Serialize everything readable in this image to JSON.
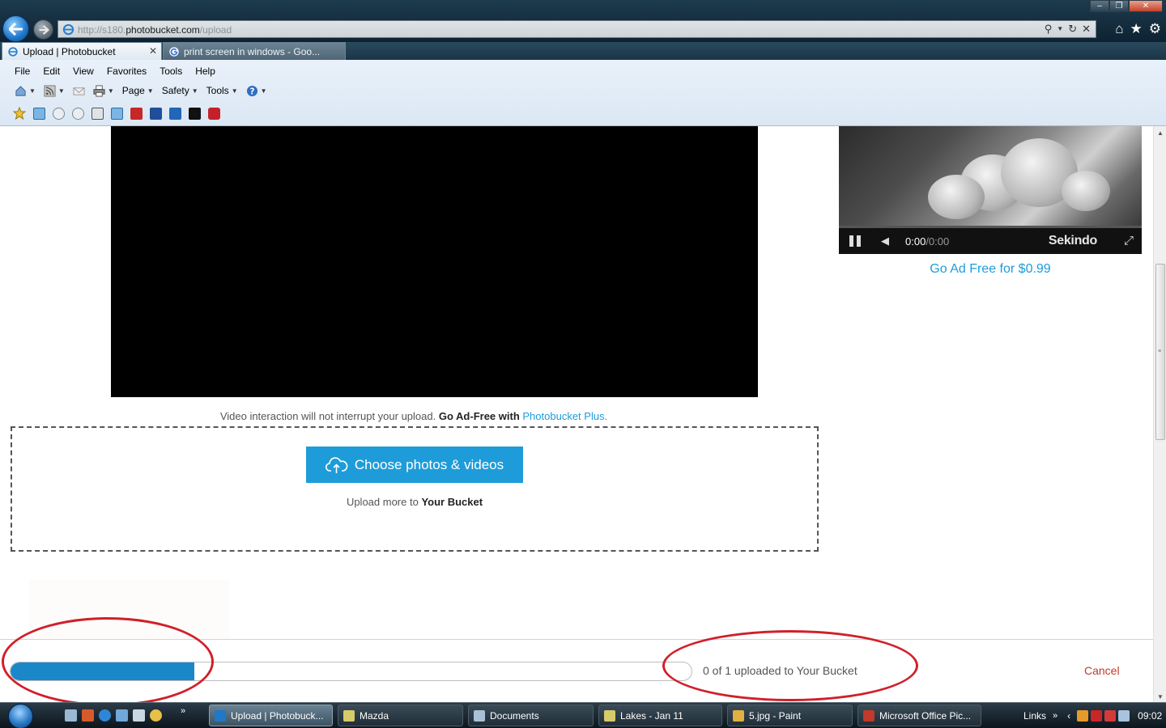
{
  "browser": {
    "address": {
      "scheme": "http://s180.",
      "host": "photobucket.com",
      "path": "/upload"
    },
    "tabs": [
      {
        "label": "Upload | Photobucket",
        "active": true
      },
      {
        "label": "print screen in windows - Goo...",
        "active": false
      }
    ],
    "menu": [
      "File",
      "Edit",
      "View",
      "Favorites",
      "Tools",
      "Help"
    ],
    "commands": {
      "page": "Page",
      "safety": "Safety",
      "tools": "Tools"
    }
  },
  "ad": {
    "time_current": "0:00",
    "time_duration": "/0:00",
    "brand": "Sekindo",
    "ad_free_link": "Go Ad Free for $0.99"
  },
  "upload": {
    "video_note_prefix": "Video interaction will not interrupt your upload.",
    "video_note_bold": "Go Ad-Free with",
    "video_note_link": "Photobucket Plus.",
    "choose_button": "Choose photos & videos",
    "upload_more_prefix": "Upload more to",
    "upload_more_bucket": "Your Bucket",
    "status": "0 of 1 uploaded to Your Bucket",
    "cancel": "Cancel",
    "progress_percent": 27
  },
  "taskbar": {
    "items": [
      {
        "label": "Upload | Photobuck...",
        "active": true,
        "color": "#1f78c8"
      },
      {
        "label": "Mazda",
        "active": false,
        "color": "#d8c96a"
      },
      {
        "label": "Documents",
        "active": false,
        "color": "#a9c0d6"
      },
      {
        "label": "Lakes - Jan 11",
        "active": false,
        "color": "#d8c96a"
      },
      {
        "label": "5.jpg - Paint",
        "active": false,
        "color": "#e0b040"
      },
      {
        "label": "Microsoft Office Pic...",
        "active": false,
        "color": "#c0392b"
      }
    ],
    "links": "Links",
    "clock": "09:02"
  },
  "colors": {
    "accent": "#1e9cd9",
    "progress": "#1a87c9",
    "cancel": "#c0392b",
    "annotation": "#d0202a"
  }
}
